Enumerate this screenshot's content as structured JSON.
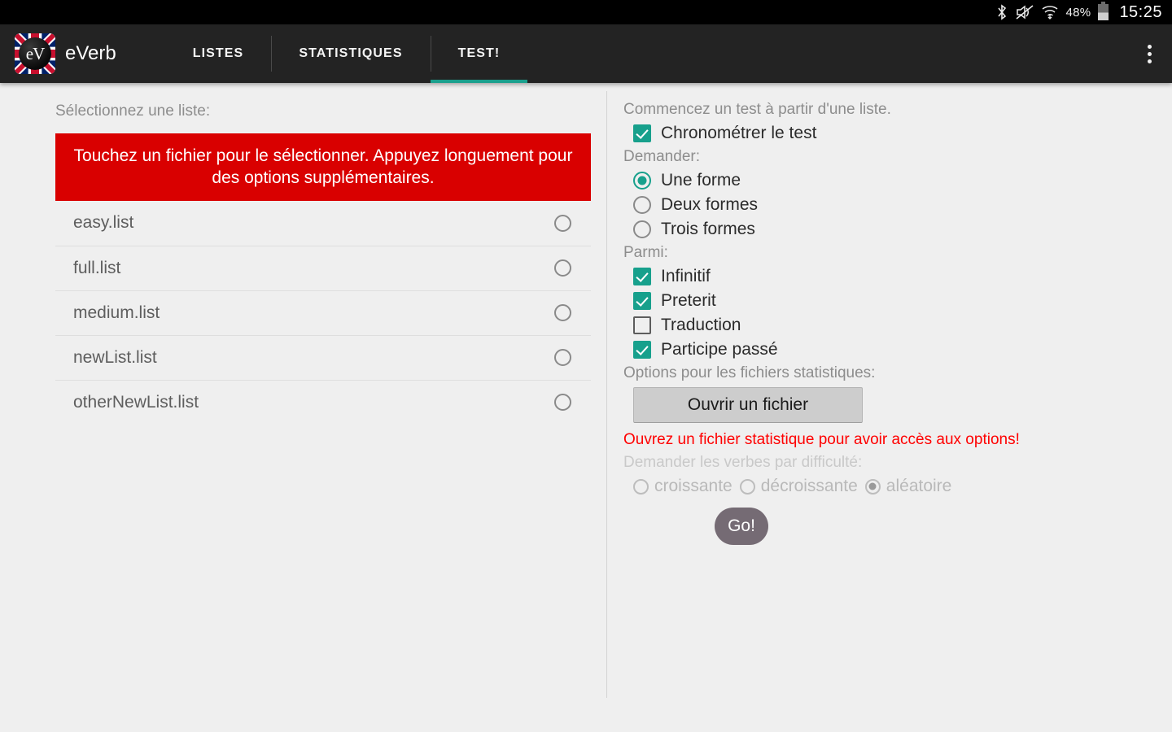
{
  "statusbar": {
    "icons": [
      "bluetooth-icon",
      "volume-mute-icon",
      "wifi-icon"
    ],
    "bluetooth_glyph": "ᛒ",
    "mute_glyph": "✕",
    "wifi_glyph": "▲",
    "battery_percent": "48%",
    "clock": "15:25"
  },
  "appbar": {
    "logo_text": "eV",
    "brand": "eVerb",
    "overflow_name": "more-options",
    "tabs": [
      {
        "label": "LISTES",
        "active": false
      },
      {
        "label": "STATISTIQUES",
        "active": false
      },
      {
        "label": "TEST!",
        "active": true
      }
    ]
  },
  "left_panel": {
    "hint": "Sélectionnez une liste:",
    "banner": "Touchez un fichier pour le sélectionner. Appuyez longuement pour des options supplémentaires.",
    "files": [
      {
        "name": "easy.list",
        "selected": false
      },
      {
        "name": "full.list",
        "selected": false
      },
      {
        "name": "medium.list",
        "selected": false
      },
      {
        "name": "newList.list",
        "selected": false
      },
      {
        "name": "otherNewList.list",
        "selected": false
      }
    ]
  },
  "right_panel": {
    "intro": "Commencez un test à partir d'une liste.",
    "timer": {
      "label": "Chronométrer le test",
      "checked": true
    },
    "ask_label": "Demander:",
    "forms": [
      {
        "label": "Une forme",
        "selected": true
      },
      {
        "label": "Deux formes",
        "selected": false
      },
      {
        "label": "Trois formes",
        "selected": false
      }
    ],
    "among_label": "Parmi:",
    "among": [
      {
        "label": "Infinitif",
        "checked": true
      },
      {
        "label": "Preterit",
        "checked": true
      },
      {
        "label": "Traduction",
        "checked": false
      },
      {
        "label": "Participe passé",
        "checked": true
      }
    ],
    "stats_label": "Options pour les fichiers statistiques:",
    "open_file_button": "Ouvrir un fichier",
    "warning": "Ouvrez un fichier statistique pour avoir accès aux options!",
    "difficulty_label": "Demander les verbes par difficulté:",
    "difficulty": [
      {
        "label": "croissante",
        "selected": false
      },
      {
        "label": "décroissante",
        "selected": false
      },
      {
        "label": "aléatoire",
        "selected": true
      }
    ],
    "go_button": "Go!"
  },
  "colors": {
    "accent_teal": "#17a08c",
    "banner_red": "#d90000",
    "warning_red": "#ff0000",
    "appbar_dark": "#232323",
    "go_button": "#756b74"
  }
}
